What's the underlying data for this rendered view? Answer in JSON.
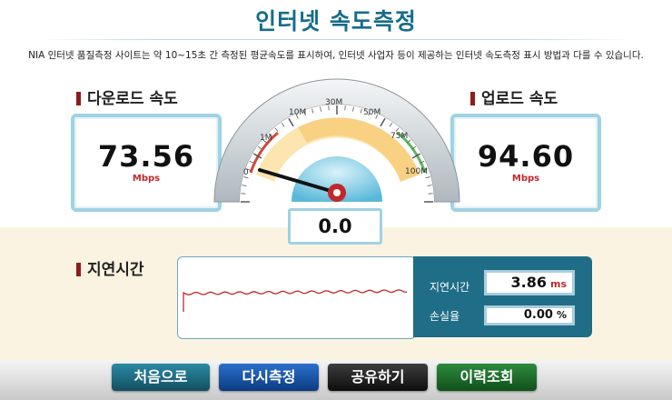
{
  "header": {
    "title": "인터넷 속도측정",
    "notice": "NIA 인터넷 품질측정 사이트는 약 10~15초 간 측정된 평균속도를 표시하여, 인터넷 사업자 등이 제공하는 인터넷 속도측정 표시 방법과 다를 수 있습니다."
  },
  "download": {
    "label": "다운로드 속도",
    "value": "73.56",
    "unit": "Mbps"
  },
  "upload": {
    "label": "업로드 속도",
    "value": "94.60",
    "unit": "Mbps"
  },
  "gauge": {
    "ticks": [
      "0",
      "1M",
      "10M",
      "30M",
      "50M",
      "75M",
      "100M"
    ],
    "readout": "0.0",
    "needle_value_mbps": 0
  },
  "latency": {
    "label": "지연시간",
    "latency_label": "지연시간",
    "latency_value": "3.86",
    "latency_unit": "ms",
    "loss_label": "손실율",
    "loss_value": "0.00",
    "loss_unit": "%"
  },
  "buttons": {
    "first": "처음으로",
    "retest": "다시측정",
    "share": "공유하기",
    "history": "이력조회"
  },
  "colors": {
    "title": "#146c8c",
    "accent_red": "#c0282b",
    "btn_first": "#1a6a80",
    "btn_retest": "#0f4fa6",
    "btn_share": "#1f1f1f",
    "btn_history": "#1b6a2a"
  }
}
